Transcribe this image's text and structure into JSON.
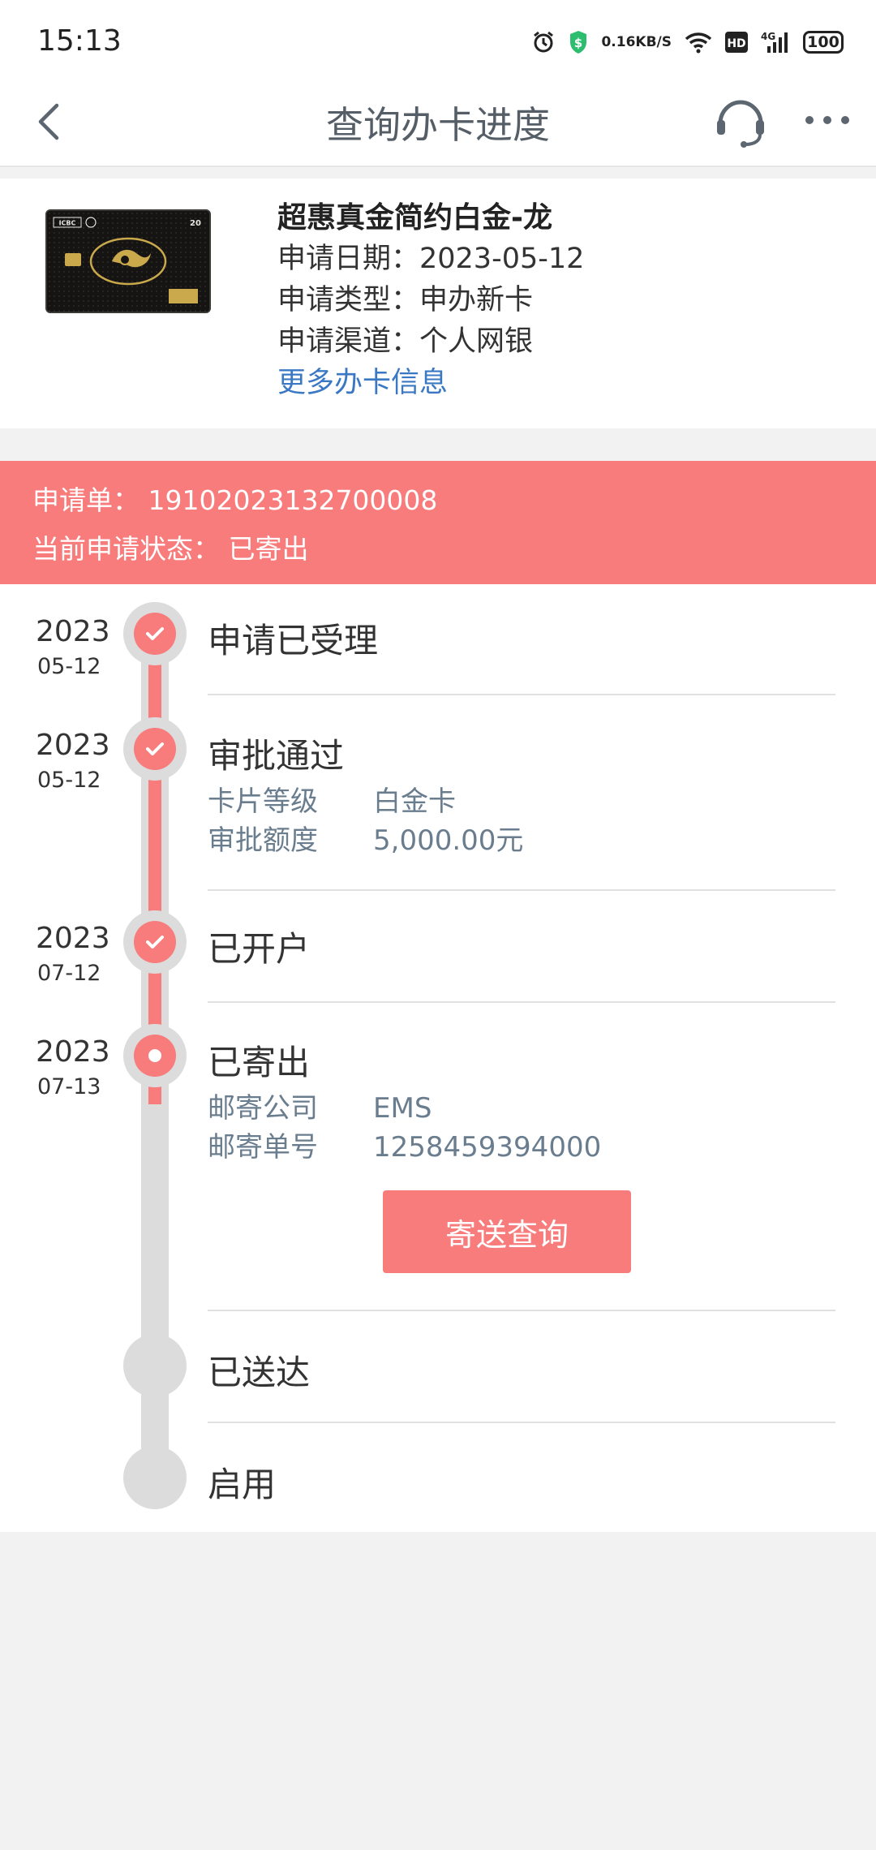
{
  "status_bar": {
    "time": "15:13",
    "net_speed_value": "0.16",
    "net_speed_unit": "KB/S",
    "hd_label": "HD",
    "signal_label": "4G",
    "battery": "100"
  },
  "nav": {
    "title": "查询办卡进度",
    "back_icon": "chevron-left-icon",
    "service_icon": "headset-icon",
    "more_icon": "more-dots-icon"
  },
  "card": {
    "name": "超惠真金简约白金-龙",
    "apply_date": "申请日期：2023-05-12",
    "apply_type": "申请类型：申办新卡",
    "apply_channel": "申请渠道：个人网银",
    "more_link": "更多办卡信息",
    "card_brand": "ICBC"
  },
  "banner": {
    "order_line": "申请单： 19102023132700008",
    "status_line": "当前申请状态： 已寄出"
  },
  "timeline": {
    "steps": [
      {
        "year": "2023",
        "md": "05-12",
        "title": "申请已受理",
        "state": "done"
      },
      {
        "year": "2023",
        "md": "05-12",
        "title": "审批通过",
        "state": "done",
        "details": [
          {
            "k": "卡片等级",
            "v": "白金卡"
          },
          {
            "k": "审批额度",
            "v": "5,000.00元"
          }
        ]
      },
      {
        "year": "2023",
        "md": "07-12",
        "title": "已开户",
        "state": "done"
      },
      {
        "year": "2023",
        "md": "07-13",
        "title": "已寄出",
        "state": "current",
        "details": [
          {
            "k": "邮寄公司",
            "v": "EMS"
          },
          {
            "k": "邮寄单号",
            "v": "1258459394000"
          }
        ],
        "button": "寄送查询"
      },
      {
        "year": "",
        "md": "",
        "title": "已送达",
        "state": "pending"
      },
      {
        "year": "",
        "md": "",
        "title": "启用",
        "state": "pending"
      }
    ]
  },
  "colors": {
    "accent": "#f87c7c",
    "link": "#3a78c3",
    "track": "#dcdcdc",
    "detail_text": "#6a7d8e"
  }
}
